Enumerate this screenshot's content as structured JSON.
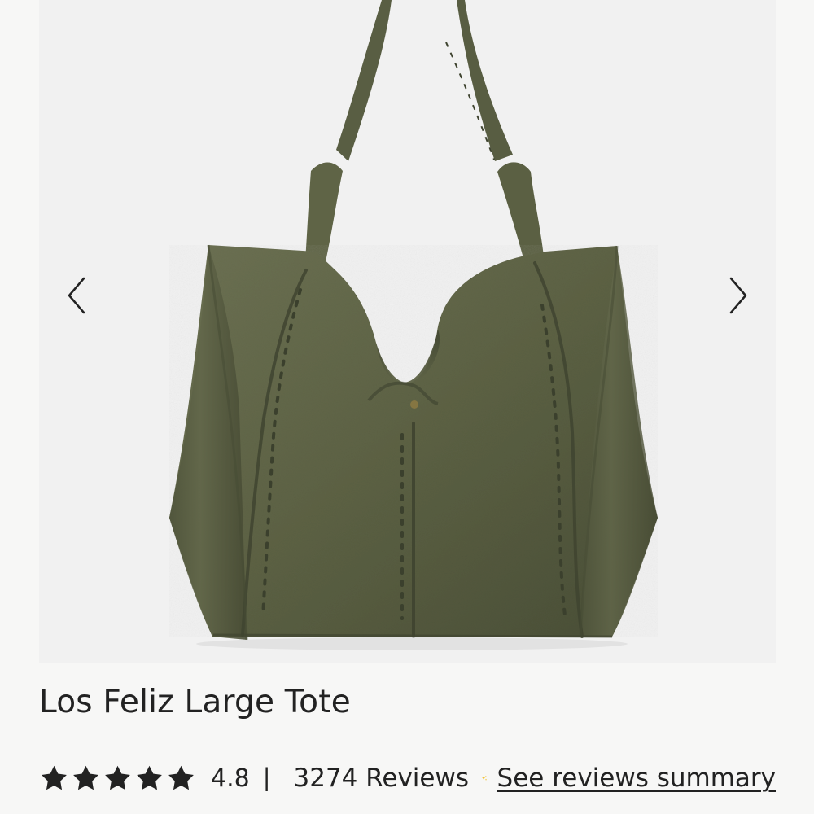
{
  "gallery": {
    "image_alt": "Los Feliz Large Tote",
    "previous_label": "Previous image",
    "next_label": "Next image"
  },
  "product": {
    "title": "Los Feliz Large Tote",
    "rating": "4.8",
    "rating_value": 4.8,
    "rating_max": 5,
    "divider": "|",
    "reviews_text": "3274 Reviews",
    "summary_link": "See reviews summary"
  },
  "colors": {
    "background": "#f7f7f6",
    "image_background": "#f1f1f1",
    "tote": "#5d6245",
    "text": "#222222",
    "sparkle": "#f2c230"
  },
  "icons": {
    "left_arrow": "chevron-left-icon",
    "right_arrow": "chevron-right-icon",
    "star": "star-icon",
    "sparkle": "sparkle-icon"
  }
}
